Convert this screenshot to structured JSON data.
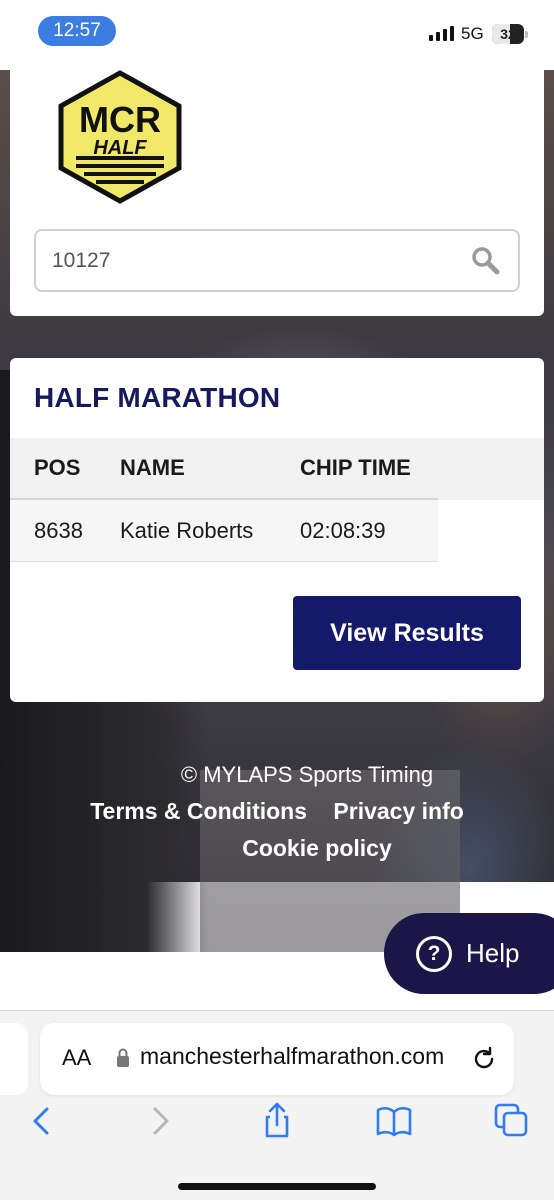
{
  "status_bar": {
    "time": "12:57",
    "network": "5G",
    "battery": "32"
  },
  "logo": {
    "line1": "MCR",
    "line2": "HALF",
    "colors": {
      "fill": "#f1e86a",
      "outline": "#111111"
    }
  },
  "search": {
    "value": "10127"
  },
  "results": {
    "race_title": "HALF MARATHON",
    "columns": [
      "POS",
      "NAME",
      "CHIP TIME"
    ],
    "rows": [
      {
        "pos": "8638",
        "name": "Katie Roberts",
        "chip_time": "02:08:39"
      }
    ],
    "view_button": "View Results"
  },
  "footer": {
    "copyright": "© MYLAPS Sports Timing",
    "links": [
      "Terms & Conditions",
      "Privacy info",
      "Cookie policy"
    ]
  },
  "help_button": {
    "label": "Help",
    "icon_glyph": "?"
  },
  "browser": {
    "text_size_label": "AA",
    "url": "manchesterhalfmarathon.com"
  },
  "colors": {
    "brand_navy": "#15196a",
    "title_navy": "#16195e",
    "time_pill": "#3b7de0",
    "ios_blue": "#2f7cf6"
  }
}
